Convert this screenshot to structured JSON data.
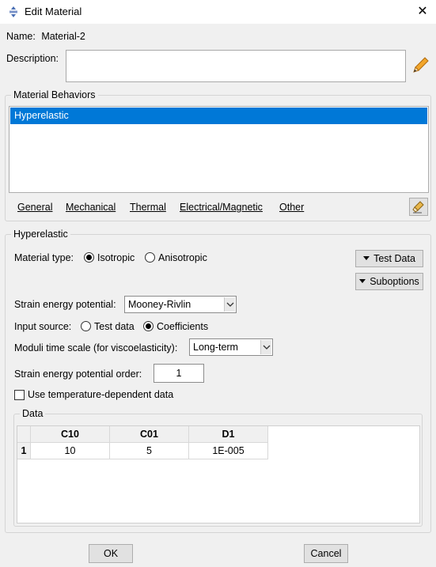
{
  "window": {
    "title": "Edit Material"
  },
  "name": {
    "label": "Name:",
    "value": "Material-2"
  },
  "description": {
    "label": "Description:",
    "value": ""
  },
  "behaviors": {
    "group_title": "Material Behaviors",
    "items": [
      "Hyperelastic"
    ],
    "menu": [
      "General",
      "Mechanical",
      "Thermal",
      "Electrical/Magnetic",
      "Other"
    ]
  },
  "hyperelastic": {
    "group_title": "Hyperelastic",
    "material_type": {
      "label": "Material type:",
      "options": [
        "Isotropic",
        "Anisotropic"
      ],
      "selected": "Isotropic"
    },
    "test_data_button": "Test Data",
    "suboptions_button": "Suboptions",
    "strain_energy_potential": {
      "label": "Strain energy potential:",
      "value": "Mooney-Rivlin"
    },
    "input_source": {
      "label": "Input source:",
      "options": [
        "Test data",
        "Coefficients"
      ],
      "selected": "Coefficients"
    },
    "moduli_time_scale": {
      "label": "Moduli time scale (for viscoelasticity):",
      "value": "Long-term"
    },
    "potential_order": {
      "label": "Strain energy potential order:",
      "value": "1"
    },
    "temperature_dependent": {
      "label": "Use temperature-dependent data",
      "checked": false
    },
    "data": {
      "group_title": "Data",
      "columns": [
        "C10",
        "C01",
        "D1"
      ],
      "rows": [
        {
          "index": "1",
          "cells": [
            "10",
            "5",
            "1E-005"
          ]
        }
      ]
    }
  },
  "footer": {
    "ok": "OK",
    "cancel": "Cancel"
  },
  "colors": {
    "selection": "#0078d7",
    "background": "#f0f0f0",
    "window": "#ffffff"
  }
}
